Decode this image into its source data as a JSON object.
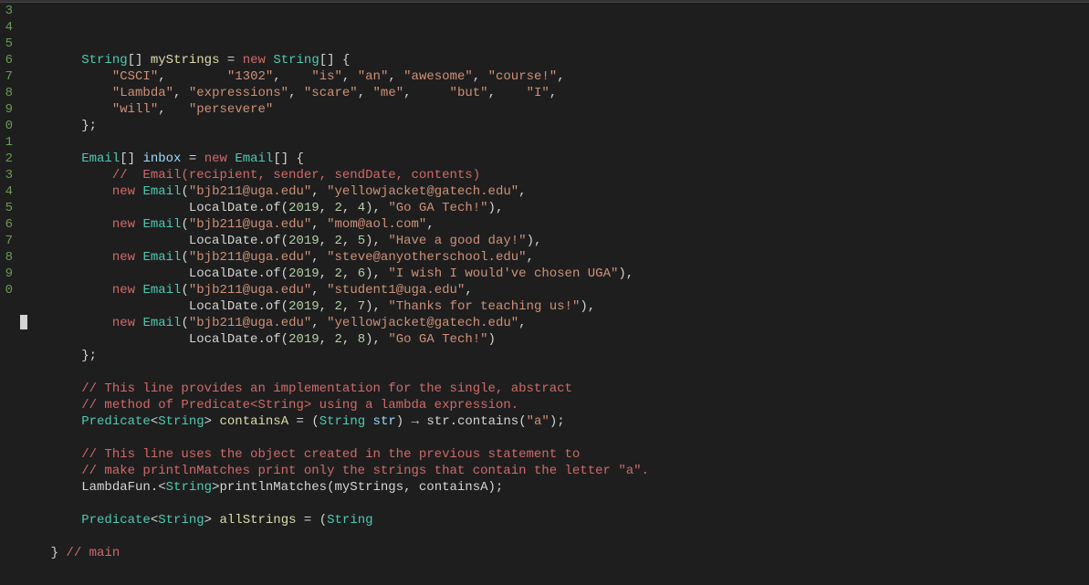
{
  "gutter_start": 3,
  "gutter_count": 18,
  "code_lines": [
    [
      {
        "c": "tk-white",
        "t": "        "
      },
      {
        "c": "tk-type",
        "t": "String"
      },
      {
        "c": "tk-punct",
        "t": "[] "
      },
      {
        "c": "tk-method",
        "t": "myStrings"
      },
      {
        "c": "tk-punct",
        "t": " = "
      },
      {
        "c": "tk-kw-red",
        "t": "new"
      },
      {
        "c": "tk-punct",
        "t": " "
      },
      {
        "c": "tk-type",
        "t": "String"
      },
      {
        "c": "tk-punct",
        "t": "[] {"
      }
    ],
    [
      {
        "c": "tk-white",
        "t": "            "
      },
      {
        "c": "tk-str",
        "t": "\"CSCI\""
      },
      {
        "c": "tk-punct",
        "t": ",        "
      },
      {
        "c": "tk-str",
        "t": "\"1302\""
      },
      {
        "c": "tk-punct",
        "t": ",    "
      },
      {
        "c": "tk-str",
        "t": "\"is\""
      },
      {
        "c": "tk-punct",
        "t": ", "
      },
      {
        "c": "tk-str",
        "t": "\"an\""
      },
      {
        "c": "tk-punct",
        "t": ", "
      },
      {
        "c": "tk-str",
        "t": "\"awesome\""
      },
      {
        "c": "tk-punct",
        "t": ", "
      },
      {
        "c": "tk-str",
        "t": "\"course!\""
      },
      {
        "c": "tk-punct",
        "t": ","
      }
    ],
    [
      {
        "c": "tk-white",
        "t": "            "
      },
      {
        "c": "tk-str",
        "t": "\"Lambda\""
      },
      {
        "c": "tk-punct",
        "t": ", "
      },
      {
        "c": "tk-str",
        "t": "\"expressions\""
      },
      {
        "c": "tk-punct",
        "t": ", "
      },
      {
        "c": "tk-str",
        "t": "\"scare\""
      },
      {
        "c": "tk-punct",
        "t": ", "
      },
      {
        "c": "tk-str",
        "t": "\"me\""
      },
      {
        "c": "tk-punct",
        "t": ",     "
      },
      {
        "c": "tk-str",
        "t": "\"but\""
      },
      {
        "c": "tk-punct",
        "t": ",    "
      },
      {
        "c": "tk-str",
        "t": "\"I\""
      },
      {
        "c": "tk-punct",
        "t": ","
      }
    ],
    [
      {
        "c": "tk-white",
        "t": "            "
      },
      {
        "c": "tk-str",
        "t": "\"will\""
      },
      {
        "c": "tk-punct",
        "t": ",   "
      },
      {
        "c": "tk-str",
        "t": "\"persevere\""
      }
    ],
    [
      {
        "c": "tk-white",
        "t": "        "
      },
      {
        "c": "tk-punct",
        "t": "};"
      }
    ],
    [
      {
        "c": "tk-white",
        "t": ""
      }
    ],
    [
      {
        "c": "tk-white",
        "t": "        "
      },
      {
        "c": "tk-type",
        "t": "Email"
      },
      {
        "c": "tk-punct",
        "t": "[] "
      },
      {
        "c": "tk-var",
        "t": "inbox"
      },
      {
        "c": "tk-punct",
        "t": " = "
      },
      {
        "c": "tk-kw-red",
        "t": "new"
      },
      {
        "c": "tk-punct",
        "t": " "
      },
      {
        "c": "tk-type",
        "t": "Email"
      },
      {
        "c": "tk-punct",
        "t": "[] {"
      }
    ],
    [
      {
        "c": "tk-white",
        "t": "            "
      },
      {
        "c": "tk-comment",
        "t": "//  Email(recipient, sender, sendDate, contents)"
      }
    ],
    [
      {
        "c": "tk-white",
        "t": "            "
      },
      {
        "c": "tk-kw-red",
        "t": "new"
      },
      {
        "c": "tk-punct",
        "t": " "
      },
      {
        "c": "tk-type",
        "t": "Email"
      },
      {
        "c": "tk-punct",
        "t": "("
      },
      {
        "c": "tk-str",
        "t": "\"bjb211@uga.edu\""
      },
      {
        "c": "tk-punct",
        "t": ", "
      },
      {
        "c": "tk-str",
        "t": "\"yellowjacket@gatech.edu\""
      },
      {
        "c": "tk-punct",
        "t": ","
      }
    ],
    [
      {
        "c": "tk-white",
        "t": "                      "
      },
      {
        "c": "tk-white",
        "t": "LocalDate.of("
      },
      {
        "c": "tk-num",
        "t": "2019"
      },
      {
        "c": "tk-punct",
        "t": ", "
      },
      {
        "c": "tk-num",
        "t": "2"
      },
      {
        "c": "tk-punct",
        "t": ", "
      },
      {
        "c": "tk-num",
        "t": "4"
      },
      {
        "c": "tk-punct",
        "t": "), "
      },
      {
        "c": "tk-str",
        "t": "\"Go GA Tech!\""
      },
      {
        "c": "tk-punct",
        "t": "),"
      }
    ],
    [
      {
        "c": "tk-white",
        "t": "            "
      },
      {
        "c": "tk-kw-red",
        "t": "new"
      },
      {
        "c": "tk-punct",
        "t": " "
      },
      {
        "c": "tk-type",
        "t": "Email"
      },
      {
        "c": "tk-punct",
        "t": "("
      },
      {
        "c": "tk-str",
        "t": "\"bjb211@uga.edu\""
      },
      {
        "c": "tk-punct",
        "t": ", "
      },
      {
        "c": "tk-str",
        "t": "\"mom@aol.com\""
      },
      {
        "c": "tk-punct",
        "t": ","
      }
    ],
    [
      {
        "c": "tk-white",
        "t": "                      "
      },
      {
        "c": "tk-white",
        "t": "LocalDate.of("
      },
      {
        "c": "tk-num",
        "t": "2019"
      },
      {
        "c": "tk-punct",
        "t": ", "
      },
      {
        "c": "tk-num",
        "t": "2"
      },
      {
        "c": "tk-punct",
        "t": ", "
      },
      {
        "c": "tk-num",
        "t": "5"
      },
      {
        "c": "tk-punct",
        "t": "), "
      },
      {
        "c": "tk-str",
        "t": "\"Have a good day!\""
      },
      {
        "c": "tk-punct",
        "t": "),"
      }
    ],
    [
      {
        "c": "tk-white",
        "t": "            "
      },
      {
        "c": "tk-kw-red",
        "t": "new"
      },
      {
        "c": "tk-punct",
        "t": " "
      },
      {
        "c": "tk-type",
        "t": "Email"
      },
      {
        "c": "tk-punct",
        "t": "("
      },
      {
        "c": "tk-str",
        "t": "\"bjb211@uga.edu\""
      },
      {
        "c": "tk-punct",
        "t": ", "
      },
      {
        "c": "tk-str",
        "t": "\"steve@anyotherschool.edu\""
      },
      {
        "c": "tk-punct",
        "t": ","
      }
    ],
    [
      {
        "c": "tk-white",
        "t": "                      "
      },
      {
        "c": "tk-white",
        "t": "LocalDate.of("
      },
      {
        "c": "tk-num",
        "t": "2019"
      },
      {
        "c": "tk-punct",
        "t": ", "
      },
      {
        "c": "tk-num",
        "t": "2"
      },
      {
        "c": "tk-punct",
        "t": ", "
      },
      {
        "c": "tk-num",
        "t": "6"
      },
      {
        "c": "tk-punct",
        "t": "), "
      },
      {
        "c": "tk-str",
        "t": "\"I wish I would've chosen UGA\""
      },
      {
        "c": "tk-punct",
        "t": "),"
      }
    ],
    [
      {
        "c": "tk-white",
        "t": "            "
      },
      {
        "c": "tk-kw-red",
        "t": "new"
      },
      {
        "c": "tk-punct",
        "t": " "
      },
      {
        "c": "tk-type",
        "t": "Email"
      },
      {
        "c": "tk-punct",
        "t": "("
      },
      {
        "c": "tk-str",
        "t": "\"bjb211@uga.edu\""
      },
      {
        "c": "tk-punct",
        "t": ", "
      },
      {
        "c": "tk-str",
        "t": "\"student1@uga.edu\""
      },
      {
        "c": "tk-punct",
        "t": ","
      }
    ],
    [
      {
        "c": "tk-white",
        "t": "                      "
      },
      {
        "c": "tk-white",
        "t": "LocalDate.of("
      },
      {
        "c": "tk-num",
        "t": "2019"
      },
      {
        "c": "tk-punct",
        "t": ", "
      },
      {
        "c": "tk-num",
        "t": "2"
      },
      {
        "c": "tk-punct",
        "t": ", "
      },
      {
        "c": "tk-num",
        "t": "7"
      },
      {
        "c": "tk-punct",
        "t": "), "
      },
      {
        "c": "tk-str",
        "t": "\"Thanks for teaching us!\""
      },
      {
        "c": "tk-punct",
        "t": "),"
      }
    ],
    [
      {
        "c": "tk-white",
        "t": "            "
      },
      {
        "c": "tk-kw-red",
        "t": "new"
      },
      {
        "c": "tk-punct",
        "t": " "
      },
      {
        "c": "tk-type",
        "t": "Email"
      },
      {
        "c": "tk-punct",
        "t": "("
      },
      {
        "c": "tk-str",
        "t": "\"bjb211@uga.edu\""
      },
      {
        "c": "tk-punct",
        "t": ", "
      },
      {
        "c": "tk-str",
        "t": "\"yellowjacket@gatech.edu\""
      },
      {
        "c": "tk-punct",
        "t": ","
      }
    ],
    [
      {
        "c": "tk-white",
        "t": "                      "
      },
      {
        "c": "tk-white",
        "t": "LocalDate.of("
      },
      {
        "c": "tk-num",
        "t": "2019"
      },
      {
        "c": "tk-punct",
        "t": ", "
      },
      {
        "c": "tk-num",
        "t": "2"
      },
      {
        "c": "tk-punct",
        "t": ", "
      },
      {
        "c": "tk-num",
        "t": "8"
      },
      {
        "c": "tk-punct",
        "t": "), "
      },
      {
        "c": "tk-str",
        "t": "\"Go GA Tech!\""
      },
      {
        "c": "tk-punct",
        "t": ")"
      }
    ],
    [
      {
        "c": "tk-white",
        "t": "        "
      },
      {
        "c": "tk-punct",
        "t": "};"
      }
    ],
    [
      {
        "c": "tk-white",
        "t": ""
      }
    ],
    [
      {
        "c": "tk-white",
        "t": "        "
      },
      {
        "c": "tk-comment",
        "t": "// This line provides an implementation for the single, abstract"
      }
    ],
    [
      {
        "c": "tk-white",
        "t": "        "
      },
      {
        "c": "tk-comment",
        "t": "// method of Predicate<String> using a lambda expression."
      }
    ],
    [
      {
        "c": "tk-white",
        "t": "        "
      },
      {
        "c": "tk-type",
        "t": "Predicate"
      },
      {
        "c": "tk-punct",
        "t": "<"
      },
      {
        "c": "tk-type",
        "t": "String"
      },
      {
        "c": "tk-punct",
        "t": "> "
      },
      {
        "c": "tk-method",
        "t": "containsA"
      },
      {
        "c": "tk-punct",
        "t": " = ("
      },
      {
        "c": "tk-type",
        "t": "String"
      },
      {
        "c": "tk-punct",
        "t": " "
      },
      {
        "c": "tk-var",
        "t": "str"
      },
      {
        "c": "tk-punct",
        "t": ") "
      },
      {
        "c": "tk-white",
        "t": "→"
      },
      {
        "c": "tk-punct",
        "t": " str.contains("
      },
      {
        "c": "tk-str",
        "t": "\"a\""
      },
      {
        "c": "tk-punct",
        "t": ");"
      }
    ],
    [
      {
        "c": "tk-white",
        "t": ""
      }
    ],
    [
      {
        "c": "tk-white",
        "t": "        "
      },
      {
        "c": "tk-comment",
        "t": "// This line uses the object created in the previous statement to"
      }
    ],
    [
      {
        "c": "tk-white",
        "t": "        "
      },
      {
        "c": "tk-comment",
        "t": "// make printlnMatches print only the strings that contain the letter \"a\"."
      }
    ],
    [
      {
        "c": "tk-white",
        "t": "        "
      },
      {
        "c": "tk-white",
        "t": "LambdaFun.<"
      },
      {
        "c": "tk-type",
        "t": "String"
      },
      {
        "c": "tk-punct",
        "t": ">printlnMatches(myStrings, containsA);"
      }
    ],
    [
      {
        "c": "tk-white",
        "t": ""
      }
    ],
    [
      {
        "c": "tk-white",
        "t": "        "
      },
      {
        "c": "tk-type",
        "t": "Predicate"
      },
      {
        "c": "tk-punct",
        "t": "<"
      },
      {
        "c": "tk-type",
        "t": "String"
      },
      {
        "c": "tk-punct",
        "t": "> "
      },
      {
        "c": "tk-method",
        "t": "allStrings"
      },
      {
        "c": "tk-punct",
        "t": " = ("
      },
      {
        "c": "tk-type",
        "t": "String"
      }
    ],
    [
      {
        "c": "tk-white",
        "t": ""
      }
    ],
    [
      {
        "c": "tk-white",
        "t": "    "
      },
      {
        "c": "tk-punct",
        "t": "} "
      },
      {
        "c": "tk-comment",
        "t": "// main"
      }
    ]
  ]
}
